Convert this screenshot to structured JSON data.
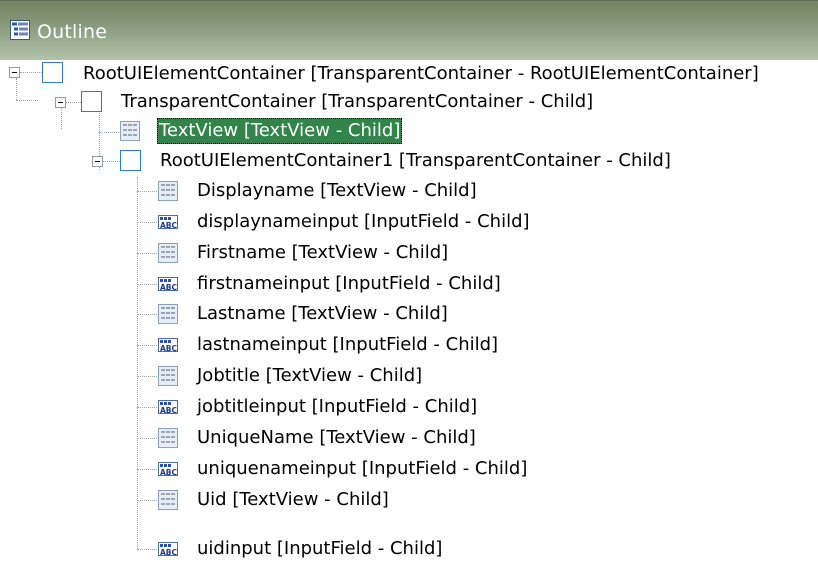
{
  "view": {
    "title": "Outline",
    "icon": "outline-view-icon"
  },
  "tree": [
    {
      "label": "RootUIElementContainer [TransparentContainer - RootUIElementContainer]",
      "icon": "container-icon",
      "expanded": true
    },
    {
      "label": "TransparentContainer [TransparentContainer - Child]",
      "icon": "container-icon",
      "expanded": true
    },
    {
      "label": "TextView [TextView - Child]",
      "icon": "textview-icon",
      "selected": true
    },
    {
      "label": "RootUIElementContainer1 [TransparentContainer - Child]",
      "icon": "container-icon",
      "expanded": true
    },
    {
      "label": "Displayname [TextView - Child]",
      "icon": "textview-icon"
    },
    {
      "label": "displaynameinput [InputField - Child]",
      "icon": "inputfield-icon"
    },
    {
      "label": "Firstname [TextView - Child]",
      "icon": "textview-icon"
    },
    {
      "label": "firstnameinput [InputField - Child]",
      "icon": "inputfield-icon"
    },
    {
      "label": "Lastname [TextView - Child]",
      "icon": "textview-icon"
    },
    {
      "label": "lastnameinput [InputField - Child]",
      "icon": "inputfield-icon"
    },
    {
      "label": "Jobtitle [TextView - Child]",
      "icon": "textview-icon"
    },
    {
      "label": "jobtitleinput [InputField - Child]",
      "icon": "inputfield-icon"
    },
    {
      "label": "UniqueName [TextView - Child]",
      "icon": "textview-icon"
    },
    {
      "label": "uniquenameinput [InputField - Child]",
      "icon": "inputfield-icon"
    },
    {
      "label": "Uid [TextView - Child]",
      "icon": "textview-icon"
    },
    {
      "label": "uidinput [InputField - Child]",
      "icon": "inputfield-icon"
    }
  ]
}
